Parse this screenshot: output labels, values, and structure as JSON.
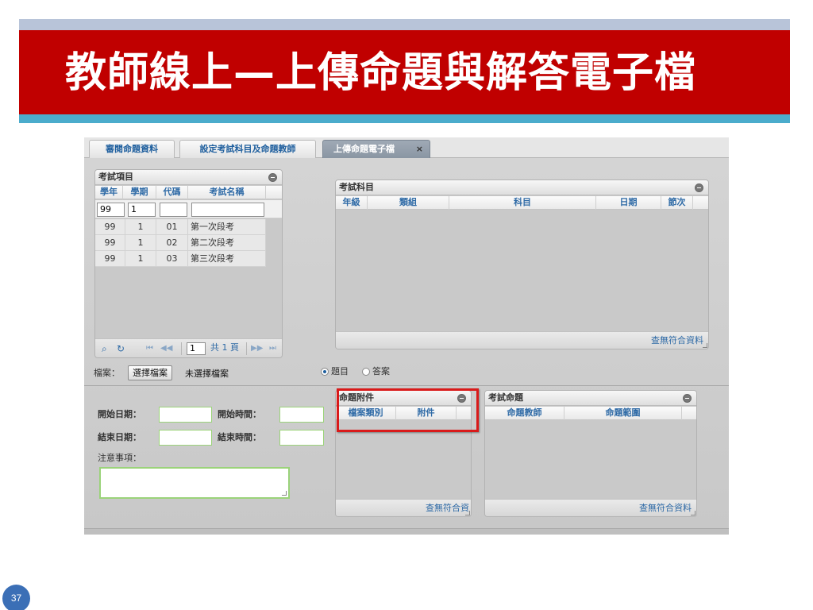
{
  "slide": {
    "title": "教師線上—上傳命題與解答電子檔",
    "page_number": "37",
    "colors": {
      "title_bar": "#c00000",
      "top_band": "#b8c4d9",
      "bottom_band": "#4baccc",
      "page_badge": "#3b6fb6",
      "highlight": "#d91a1a"
    }
  },
  "tabs": [
    {
      "label": "審閱命題資料"
    },
    {
      "label": "設定考試科目及命題教師"
    },
    {
      "label": "上傳命題電子檔",
      "active": true,
      "close_icon": "×"
    }
  ],
  "exam_items": {
    "title": "考試項目",
    "columns": [
      "學年",
      "學期",
      "代碼",
      "考試名稱"
    ],
    "filter": {
      "year": "99",
      "term": "1",
      "code": "",
      "name": ""
    },
    "rows": [
      {
        "year": "99",
        "term": "1",
        "code": "01",
        "name": "第一次段考"
      },
      {
        "year": "99",
        "term": "1",
        "code": "02",
        "name": "第二次段考"
      },
      {
        "year": "99",
        "term": "1",
        "code": "03",
        "name": "第三次段考"
      }
    ],
    "pager": {
      "search_icon": "⌕",
      "refresh_icon": "↻",
      "first": "⏮",
      "prev": "◀◀",
      "page": "1",
      "total": "共 1 頁",
      "next": "▶▶",
      "last": "⏭"
    }
  },
  "exam_subjects": {
    "title": "考試科目",
    "columns": [
      "年級",
      "類組",
      "科目",
      "日期",
      "節次"
    ],
    "no_data": "查無符合資料"
  },
  "file_row": {
    "label": "檔案：",
    "choose_button": "選擇檔案",
    "no_file": "未選擇檔案",
    "radio_question": "題目",
    "radio_answer": "答案"
  },
  "form": {
    "start_date": "開始日期：",
    "start_time": "開始時間：",
    "end_date": "結束日期：",
    "end_time": "結束時間：",
    "notes": "注意事項："
  },
  "attachments": {
    "title": "命題附件",
    "columns": [
      "檔案類別",
      "附件"
    ],
    "no_data": "查無符合資"
  },
  "exam_questions": {
    "title": "考試命題",
    "columns": [
      "命題教師",
      "命題範圍"
    ],
    "no_data": "查無符合資料"
  }
}
